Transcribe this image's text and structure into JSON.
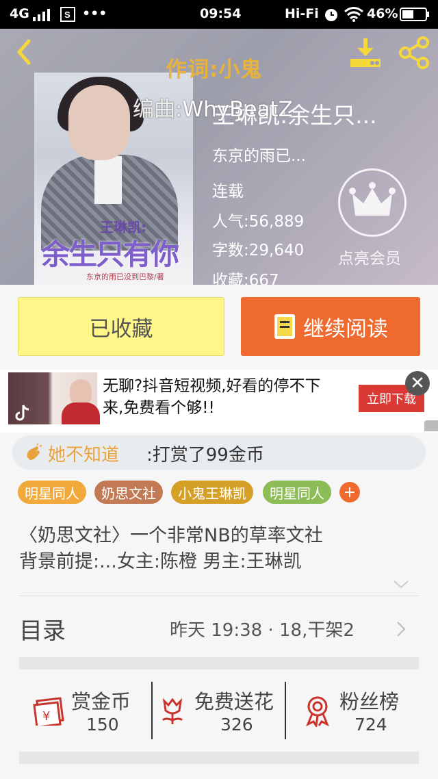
{
  "status_bar": {
    "network": "4G",
    "time": "09:54",
    "hifi": "Hi-Fi",
    "battery": "46%"
  },
  "header": {
    "lyric_label": "作词",
    "lyric_value": ":小鬼",
    "composer_label": "编曲:",
    "composer_value": "WhyBeatZ"
  },
  "cover": {
    "title_line1": "王琳凯:",
    "title_line2": "余生只有你",
    "byline": "东京的雨已没到巴黎/著"
  },
  "book": {
    "title": "王琳凯:余生只...",
    "author": "东京的雨已...",
    "status": "连载",
    "popularity_label": "人气:",
    "popularity": "56,889",
    "words_label": "字数:",
    "words": "29,640",
    "favorites_label": "收藏:",
    "favorites": "667",
    "vip_label": "点亮会员"
  },
  "actions": {
    "collected": "已收藏",
    "continue": "继续阅读"
  },
  "ad": {
    "text": "无聊?抖音短视频,好看的停不下来,免费看个够!!",
    "cta": "立即下载"
  },
  "reward": {
    "user": "她不知道",
    "message": ":打赏了99金币"
  },
  "tags": [
    {
      "label": "明星同人",
      "color": "#f2a93b"
    },
    {
      "label": "奶思文社",
      "color": "#c27a55"
    },
    {
      "label": "小鬼王琳凯",
      "color": "#d4a028"
    },
    {
      "label": "明星同人",
      "color": "#8cbc55"
    }
  ],
  "intro": {
    "line1": "〈奶思文社〉一个非常NB的草率文社",
    "line2": "背景前提:...女主:陈橙 男主:王琳凯"
  },
  "toc": {
    "label": "目录",
    "update": "昨天 19:38 · 18,干架2"
  },
  "bottom": {
    "coins_label": "赏金币",
    "coins": "150",
    "flowers_label": "免费送花",
    "flowers": "326",
    "fans_label": "粉丝榜",
    "fans": "724"
  }
}
